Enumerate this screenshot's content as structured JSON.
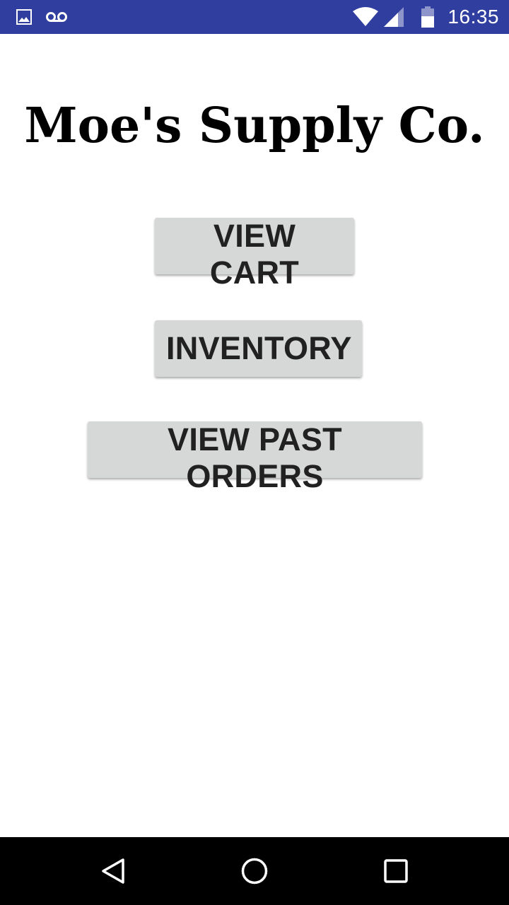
{
  "status_bar": {
    "time": "16:35",
    "icons": [
      "image-icon",
      "voicemail-icon",
      "wifi-icon",
      "signal-icon",
      "battery-icon"
    ],
    "background": "#303f9f"
  },
  "app": {
    "title": "Moe's Supply Co."
  },
  "buttons": {
    "view_cart": "VIEW CART",
    "inventory": "INVENTORY",
    "view_past_orders": "VIEW PAST ORDERS"
  },
  "nav_bar": {
    "icons": [
      "back-icon",
      "home-icon",
      "recents-icon"
    ]
  },
  "colors": {
    "button_bg": "#d6d7d7",
    "button_text": "#212121"
  }
}
